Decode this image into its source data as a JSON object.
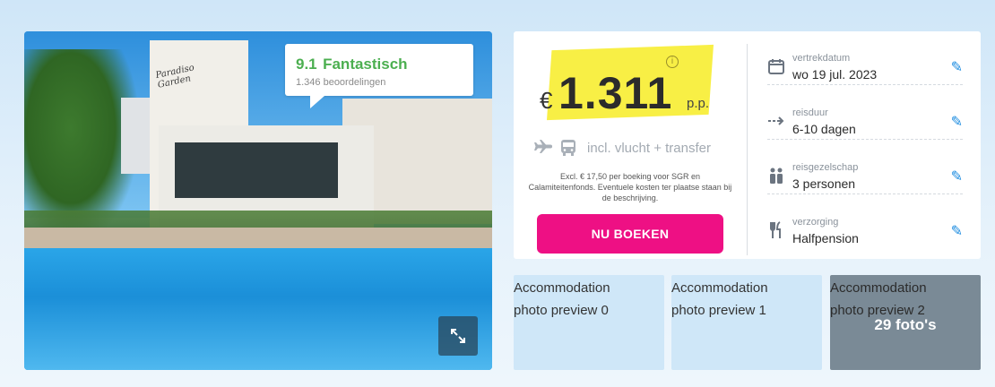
{
  "hero": {
    "logo_text": "Paradiso Garden",
    "rating_score": "9.1",
    "rating_label": "Fantastisch",
    "rating_count": "1.346 beoordelingen",
    "expand_icon": "expand-arrows-icon"
  },
  "price": {
    "currency": "€",
    "value": "1.311",
    "suffix": "p.p.",
    "info_icon": "i",
    "included": "incl. vlucht + transfer",
    "excl_note": "Excl. € 17,50 per boeking voor SGR en Calamiteitenfonds. Eventuele kosten ter plaatse staan bij de beschrijving.",
    "book_label": "NU BOEKEN",
    "highlight_color": "#f8ee3b",
    "book_color": "#ee1084"
  },
  "details": [
    {
      "icon": "calendar-icon",
      "label": "vertrekdatum",
      "value": "wo 19 jul. 2023"
    },
    {
      "icon": "duration-arrow-icon",
      "label": "reisduur",
      "value": "6-10 dagen"
    },
    {
      "icon": "people-icon",
      "label": "reisgezelschap",
      "value": "3 personen"
    },
    {
      "icon": "cutlery-icon",
      "label": "verzorging",
      "value": "Halfpension"
    }
  ],
  "thumbnails": [
    {
      "line1": "Accommodation",
      "line2": "photo preview 0"
    },
    {
      "line1": "Accommodation",
      "line2": "photo preview 1"
    },
    {
      "line1": "Accommodation",
      "line2": "photo preview 2",
      "overlay": "29 foto's"
    }
  ]
}
